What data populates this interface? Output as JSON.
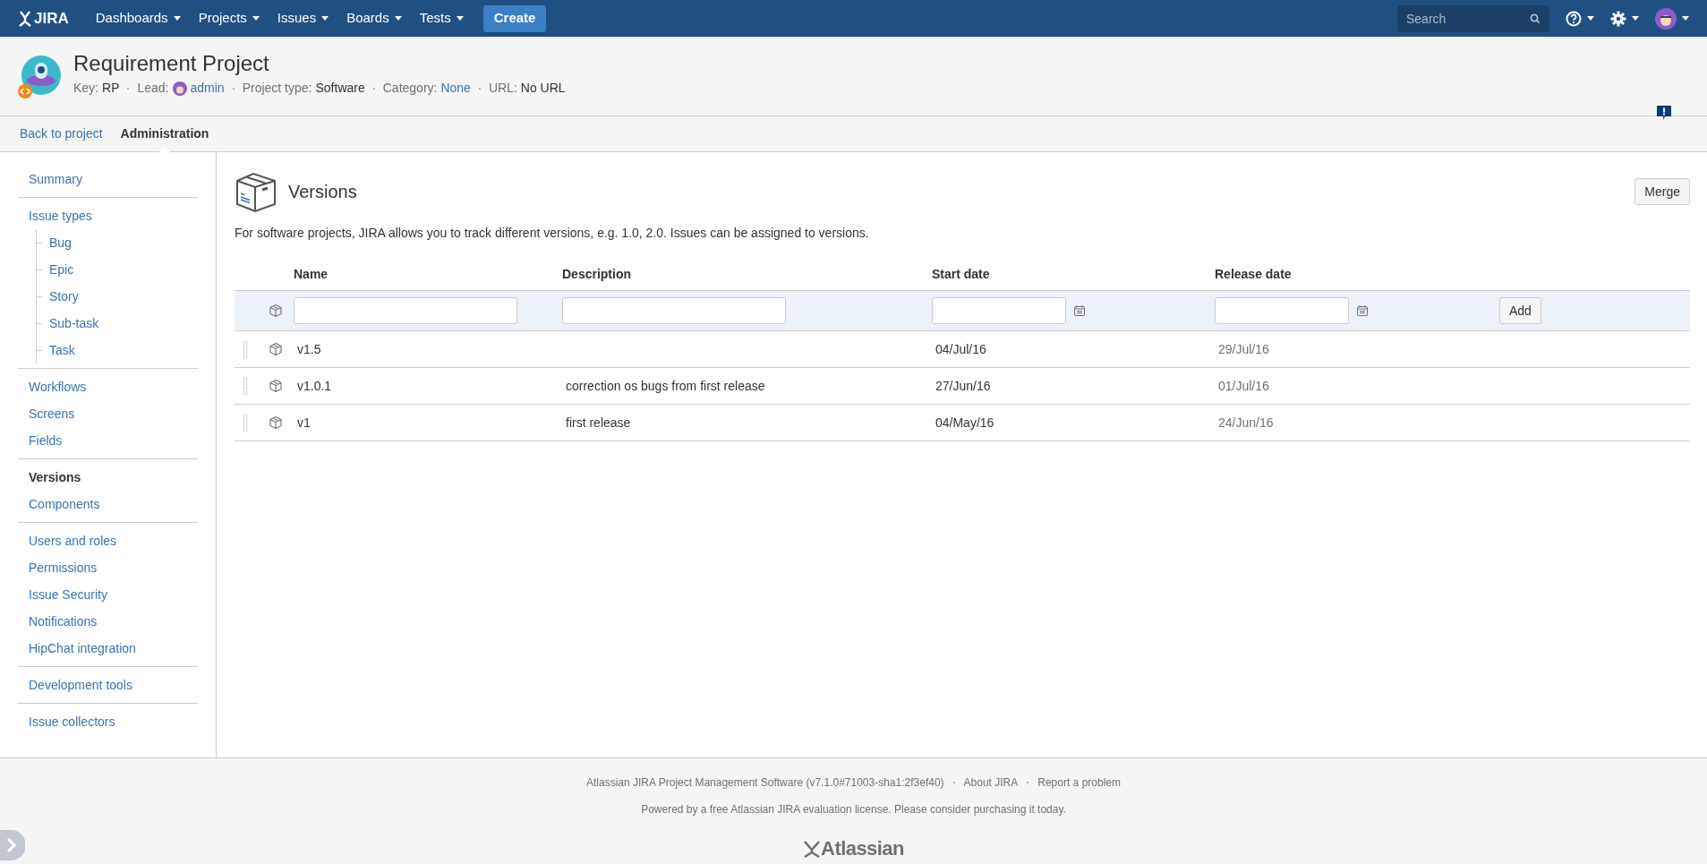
{
  "nav": {
    "logo": "JIRA",
    "menus": [
      "Dashboards",
      "Projects",
      "Issues",
      "Boards",
      "Tests"
    ],
    "create": "Create",
    "search": {
      "placeholder": "Search"
    }
  },
  "project": {
    "title": "Requirement Project",
    "meta": [
      {
        "label": "Key:",
        "value": "RP",
        "kind": "text"
      },
      {
        "label": "Lead:",
        "value": "admin",
        "kind": "user"
      },
      {
        "label": "Project type:",
        "value": "Software",
        "kind": "text"
      },
      {
        "label": "Category:",
        "value": "None",
        "kind": "link"
      },
      {
        "label": "URL:",
        "value": "No URL",
        "kind": "text"
      }
    ]
  },
  "tabs": [
    {
      "label": "Back to project",
      "selected": false
    },
    {
      "label": "Administration",
      "selected": true
    }
  ],
  "sidebar": {
    "groups": [
      [
        {
          "label": "Summary",
          "selected": false
        }
      ],
      [
        {
          "label": "Issue types",
          "selected": false,
          "children": [
            {
              "label": "Bug",
              "selected": false
            },
            {
              "label": "Epic",
              "selected": false
            },
            {
              "label": "Story",
              "selected": false
            },
            {
              "label": "Sub-task",
              "selected": false
            },
            {
              "label": "Task",
              "selected": false
            }
          ]
        }
      ],
      [
        {
          "label": "Workflows",
          "selected": false
        },
        {
          "label": "Screens",
          "selected": false
        },
        {
          "label": "Fields",
          "selected": false
        }
      ],
      [
        {
          "label": "Versions",
          "selected": true
        },
        {
          "label": "Components",
          "selected": false
        }
      ],
      [
        {
          "label": "Users and roles",
          "selected": false
        },
        {
          "label": "Permissions",
          "selected": false
        },
        {
          "label": "Issue Security",
          "selected": false
        },
        {
          "label": "Notifications",
          "selected": false
        },
        {
          "label": "HipChat integration",
          "selected": false
        }
      ],
      [
        {
          "label": "Development tools",
          "selected": false
        }
      ],
      [
        {
          "label": "Issue collectors",
          "selected": false
        }
      ]
    ]
  },
  "page": {
    "title": "Versions",
    "merge": "Merge",
    "description": "For software projects, JIRA allows you to track different versions, e.g. 1.0, 2.0. Issues can be assigned to versions."
  },
  "table": {
    "columns": [
      "Name",
      "Description",
      "Start date",
      "Release date"
    ],
    "add": "Add",
    "rows": [
      {
        "name": "v1.5",
        "description": "",
        "start": "04/Jul/16",
        "release": "29/Jul/16"
      },
      {
        "name": "v1.0.1",
        "description": "correction os bugs from first release",
        "start": "27/Jun/16",
        "release": "01/Jul/16"
      },
      {
        "name": "v1",
        "description": "first release",
        "start": "04/May/16",
        "release": "24/Jun/16"
      }
    ]
  },
  "footer": {
    "links": [
      "Atlassian JIRA Project Management Software (v7.1.0#71003-sha1:2f3ef40)",
      "About JIRA",
      "Report a problem"
    ],
    "license": "Powered by a free Atlassian JIRA evaluation license. Please consider purchasing it today.",
    "logo": "Atlassian"
  }
}
